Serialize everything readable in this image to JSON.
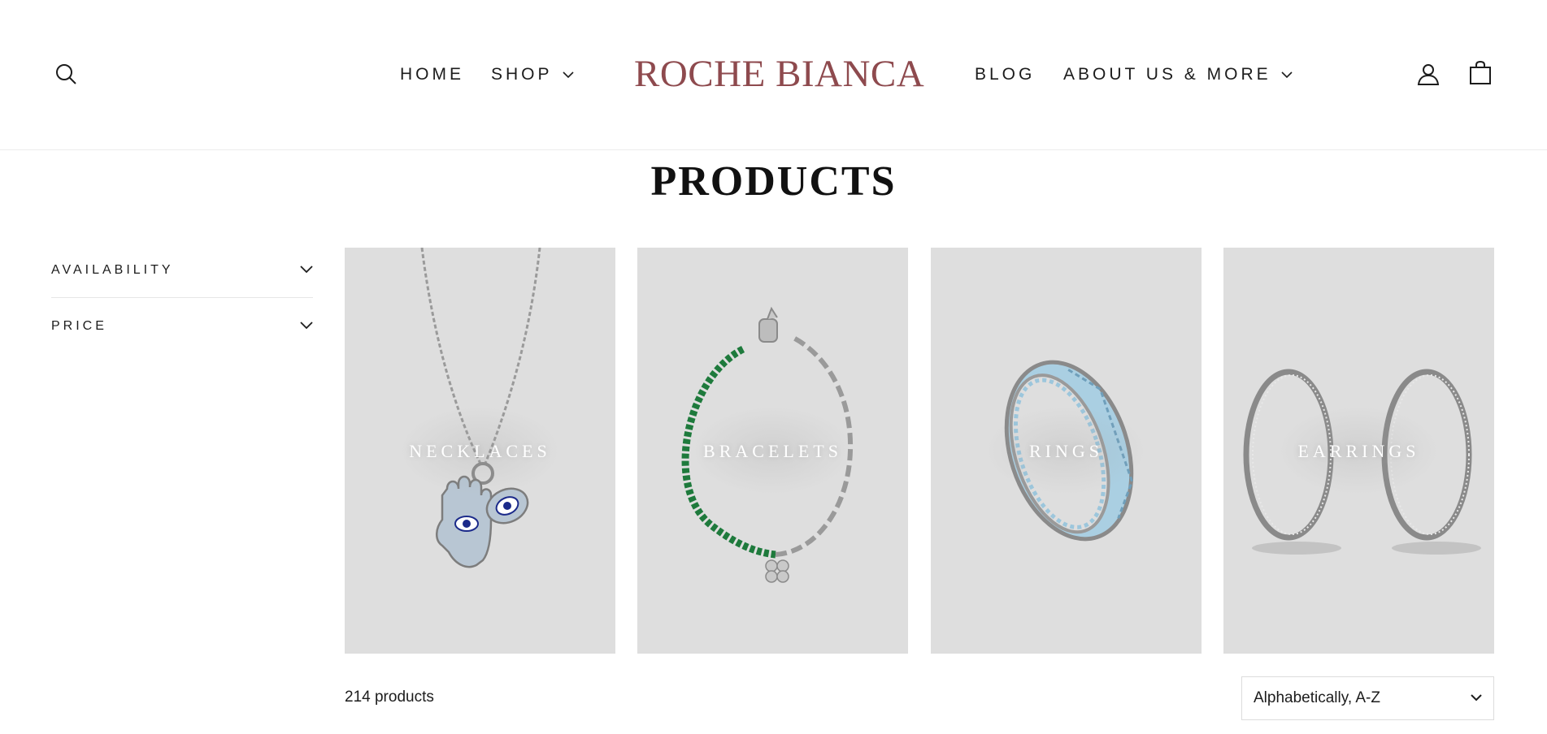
{
  "header": {
    "logo": "ROCHE BIANCA",
    "nav": {
      "home": "HOME",
      "shop": "SHOP",
      "blog": "BLOG",
      "about": "ABOUT US & MORE"
    },
    "icons": {
      "search": "search-icon",
      "account": "user-icon",
      "cart": "bag-icon",
      "dropdown": "chevron-down-icon"
    }
  },
  "page": {
    "title": "PRODUCTS"
  },
  "filters": [
    {
      "label": "AVAILABILITY"
    },
    {
      "label": "PRICE"
    }
  ],
  "categories": [
    {
      "label": "NECKLACES"
    },
    {
      "label": "BRACELETS"
    },
    {
      "label": "RINGS"
    },
    {
      "label": "EARRINGS"
    }
  ],
  "listing": {
    "count": "214 products",
    "sort": {
      "selected": "Alphabetically, A-Z"
    }
  },
  "colors": {
    "logo": "#8e4a4e",
    "tile_background": "#dedede",
    "emerald": "#1e7a3c",
    "aquamarine": "#8fc3dc",
    "evil_eye_blue": "#1b2a8a"
  }
}
